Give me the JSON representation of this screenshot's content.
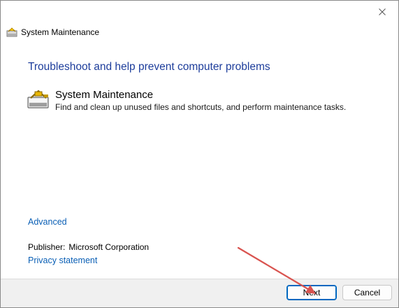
{
  "window": {
    "title": "System Maintenance",
    "close_icon": "close-icon"
  },
  "main": {
    "heading": "Troubleshoot and help prevent computer problems",
    "task": {
      "title": "System Maintenance",
      "description": "Find and clean up unused files and shortcuts, and perform maintenance tasks.",
      "icon": "maintenance-icon"
    },
    "advanced_label": "Advanced",
    "publisher_label": "Publisher:",
    "publisher_value": "Microsoft Corporation",
    "privacy_label": "Privacy statement"
  },
  "footer": {
    "next_label": "Next",
    "cancel_label": "Cancel"
  },
  "colors": {
    "heading": "#1d3d9b",
    "link": "#0a5fb5",
    "primary_button_border": "#0067c0",
    "annotation_arrow": "#d9534f"
  }
}
